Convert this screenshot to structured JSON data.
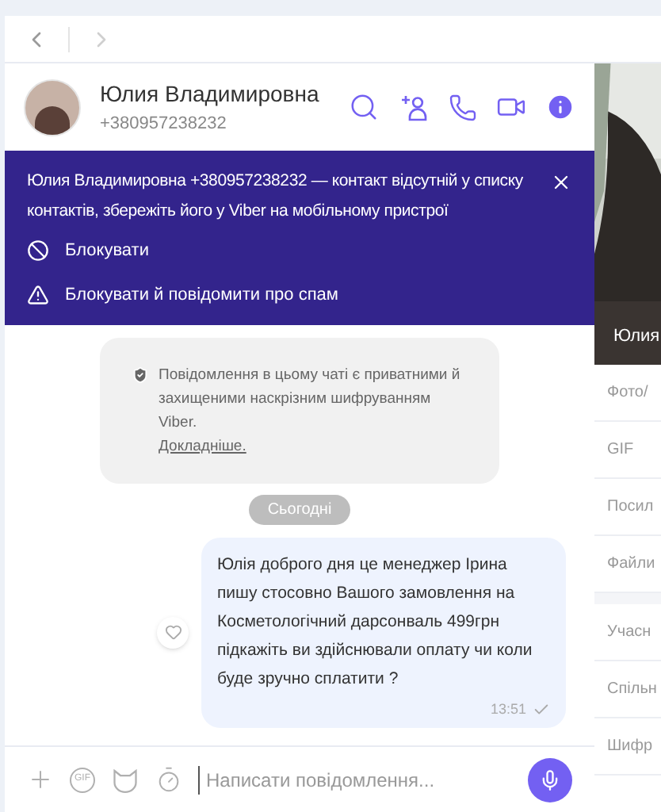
{
  "contact": {
    "name": "Юлия Владимировна",
    "phone": "+380957238232"
  },
  "banner": {
    "text": "Юлия Владимировна +380957238232 — контакт відсутній у списку контактів, збережіть його у Viber на мобільному пристрої",
    "actions": [
      {
        "kind": "block",
        "label": "Блокувати"
      },
      {
        "kind": "report",
        "label": "Блокувати й повідомити про спам"
      }
    ]
  },
  "security_notice": {
    "text": "Повідомлення в цьому чаті є приватними й захищеними наскрізним шифруванням Viber.",
    "link": "Докладніше."
  },
  "date_separator": "Сьогодні",
  "messages": [
    {
      "text": "Юлія доброго дня це менеджер Ірина пишу стосовно Вашого замовлення на Косметологічний дарсонваль 499грн підкажіть ви здійснювали оплату чи коли буде зручно сплатити ?",
      "time": "13:51",
      "liked": false
    }
  ],
  "composer": {
    "gif_label": "GIF",
    "placeholder": "Написати повідомлення..."
  },
  "side_panel": {
    "photo_caption": "Юлия",
    "groups": [
      [
        "Фото/",
        "GIF",
        "Посил",
        "Файли"
      ],
      [
        "Учасн",
        "Спільн",
        "Шифр"
      ]
    ]
  }
}
